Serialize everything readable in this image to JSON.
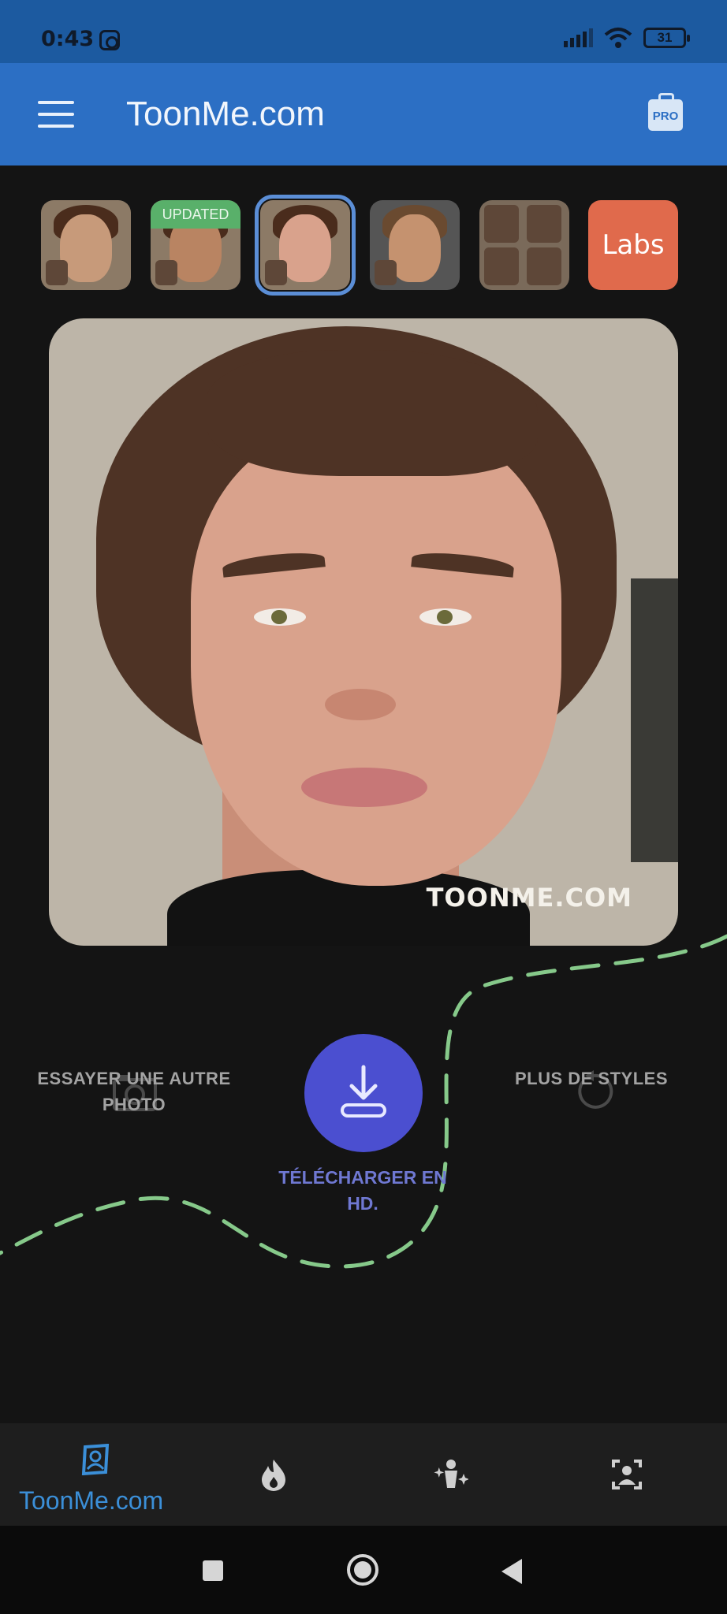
{
  "status_bar": {
    "time": "0:43",
    "battery": "31",
    "icons": [
      "instagram-icon",
      "signal-icon",
      "wifi-icon",
      "battery-icon"
    ]
  },
  "app_bar": {
    "title": "ToonMe.com",
    "menu_icon": "menu-icon",
    "pro_label": "PRO"
  },
  "styles": {
    "items": [
      {
        "badge": ""
      },
      {
        "badge": "UPDATED"
      },
      {
        "badge": "",
        "selected": true
      },
      {
        "badge": ""
      },
      {
        "badge": ""
      }
    ],
    "labs_label": "Labs"
  },
  "result": {
    "watermark": "TOONME.COM"
  },
  "actions": {
    "try_another": "ESSAYER UNE AUTRE PHOTO",
    "download": "TÉLÉCHARGER EN HD.",
    "more_styles": "PLUS DE STYLES"
  },
  "bottom_nav": {
    "active_label": "ToonMe.com",
    "items": [
      "portrait-icon",
      "flame-icon",
      "sparkle-figure-icon",
      "face-frame-icon"
    ]
  },
  "colors": {
    "status_bar": "#1c5aa0",
    "app_bar": "#2c6fc4",
    "background": "#141414",
    "download_button": "#4b4fd0",
    "dashed_line": "#86c98a",
    "nav_active": "#3b8fd8",
    "labs_tile": "#e06a4c",
    "updated_badge": "#59b06a"
  }
}
